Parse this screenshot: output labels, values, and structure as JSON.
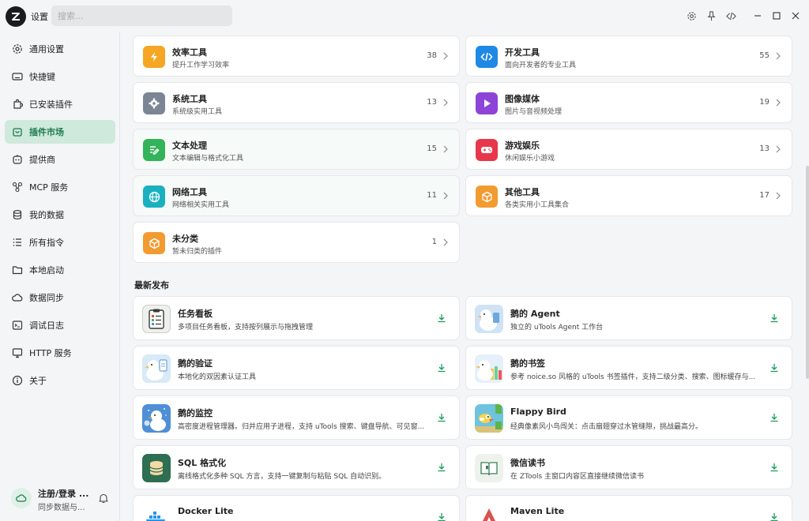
{
  "app": {
    "title": "设置"
  },
  "search": {
    "placeholder": "搜索..."
  },
  "colors": {
    "accent": "#1d7a4f",
    "active_bg": "#cfe9dc"
  },
  "sidebar": {
    "items": [
      {
        "label": "通用设置",
        "icon": "gear-icon"
      },
      {
        "label": "快捷键",
        "icon": "keyboard-icon"
      },
      {
        "label": "已安装插件",
        "icon": "puzzle-icon"
      },
      {
        "label": "插件市场",
        "icon": "shopping-bag-icon",
        "active": true
      },
      {
        "label": "提供商",
        "icon": "robot-icon"
      },
      {
        "label": "MCP 服务",
        "icon": "network-icon"
      },
      {
        "label": "我的数据",
        "icon": "database-icon"
      },
      {
        "label": "所有指令",
        "icon": "list-icon"
      },
      {
        "label": "本地启动",
        "icon": "folder-icon"
      },
      {
        "label": "数据同步",
        "icon": "cloud-sync-icon"
      },
      {
        "label": "调试日志",
        "icon": "terminal-icon"
      },
      {
        "label": "HTTP 服务",
        "icon": "monitor-icon"
      },
      {
        "label": "关于",
        "icon": "info-icon"
      }
    ],
    "user": {
      "name": "注册/登录 ...",
      "sub": "同步数据与..."
    }
  },
  "categories": [
    {
      "title": "效率工具",
      "desc": "提升工作学习效率",
      "count": "38",
      "color": "#f5a623",
      "icon": "lightning-icon"
    },
    {
      "title": "开发工具",
      "desc": "面向开发者的专业工具",
      "count": "55",
      "color": "#1e88e5",
      "icon": "code-icon"
    },
    {
      "title": "系统工具",
      "desc": "系统级实用工具",
      "count": "13",
      "color": "#7b8594",
      "icon": "gear-icon"
    },
    {
      "title": "图像媒体",
      "desc": "图片与音视频处理",
      "count": "19",
      "color": "#8e44d6",
      "icon": "play-icon"
    },
    {
      "title": "文本处理",
      "desc": "文本编辑与格式化工具",
      "count": "15",
      "color": "#33b35a",
      "icon": "edit-icon"
    },
    {
      "title": "游戏娱乐",
      "desc": "休闲娱乐小游戏",
      "count": "13",
      "color": "#e8374b",
      "icon": "gamepad-icon"
    },
    {
      "title": "网络工具",
      "desc": "网络相关实用工具",
      "count": "11",
      "color": "#1ab0c0",
      "icon": "globe-icon"
    },
    {
      "title": "其他工具",
      "desc": "各类实用小工具集合",
      "count": "17",
      "color": "#f29b30",
      "icon": "box-icon"
    },
    {
      "title": "未分类",
      "desc": "暂未归类的插件",
      "count": "1",
      "color": "#f29b30",
      "icon": "box-icon"
    }
  ],
  "latest": {
    "title": "最新发布",
    "items": [
      {
        "title": "任务看板",
        "desc": "多项目任务看板，支持按列展示与拖拽管理",
        "icon": "kanban-icon"
      },
      {
        "title": "鹅的 Agent",
        "desc": "独立的 uTools Agent 工作台",
        "icon": "goose-icon"
      },
      {
        "title": "鹅的验证",
        "desc": "本地化的双因素认证工具",
        "icon": "goose-icon"
      },
      {
        "title": "鹅的书签",
        "desc": "参考 noice.so 风格的 uTools 书签插件，支持二级分类、搜索、图标缓存与...",
        "icon": "goose-icon"
      },
      {
        "title": "鹅的监控",
        "desc": "高密度进程管理器。归并应用子进程，支持 uTools 搜索、键盘导航、可见窗...",
        "icon": "goose-icon"
      },
      {
        "title": "Flappy Bird",
        "desc": "经典像素风小鸟闯关：点击扇翅穿过水管缝隙，挑战最高分。",
        "icon": "bird-icon"
      },
      {
        "title": "SQL 格式化",
        "desc": "离线格式化多种 SQL 方言，支持一键复制与粘贴 SQL 自动识别。",
        "icon": "database-icon"
      },
      {
        "title": "微信读书",
        "desc": "在 ZTools 主窗口内容区直接继续微信读书",
        "icon": "book-icon"
      },
      {
        "title": "Docker Lite",
        "desc": "",
        "icon": "docker-icon"
      },
      {
        "title": "Maven Lite",
        "desc": "",
        "icon": "maven-icon"
      }
    ]
  }
}
